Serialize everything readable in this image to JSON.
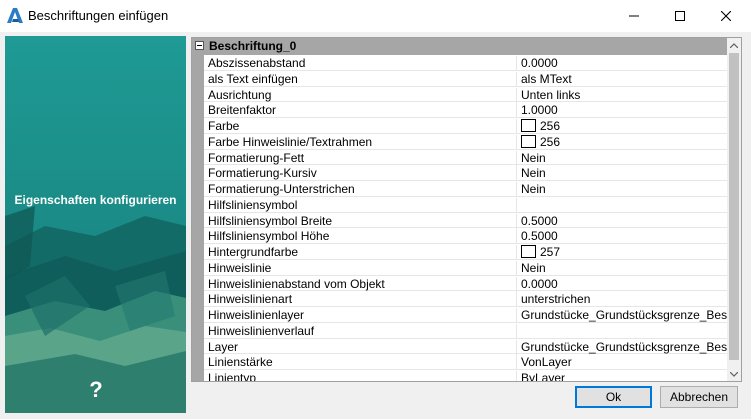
{
  "window": {
    "title": "Beschriftungen einfügen",
    "minimize": "–",
    "maximize": "☐",
    "close": "✕"
  },
  "sidebar": {
    "title": "Eigenschaften konfigurieren",
    "help": "?"
  },
  "category": {
    "label": "Beschriftung_0",
    "toggle": "−"
  },
  "properties": [
    {
      "name": "Abszissenabstand",
      "value": "0.0000"
    },
    {
      "name": "als Text einfügen",
      "value": "als MText"
    },
    {
      "name": "Ausrichtung",
      "value": "Unten links"
    },
    {
      "name": "Breitenfaktor",
      "value": "1.0000"
    },
    {
      "name": "Farbe",
      "value": "256",
      "swatch": true
    },
    {
      "name": "Farbe Hinweislinie/Textrahmen",
      "value": "256",
      "swatch": true
    },
    {
      "name": "Formatierung-Fett",
      "value": "Nein"
    },
    {
      "name": "Formatierung-Kursiv",
      "value": "Nein"
    },
    {
      "name": "Formatierung-Unterstrichen",
      "value": "Nein"
    },
    {
      "name": "Hilfsliniensymbol",
      "value": ""
    },
    {
      "name": "Hilfsliniensymbol Breite",
      "value": "0.5000"
    },
    {
      "name": "Hilfsliniensymbol Höhe",
      "value": "0.5000"
    },
    {
      "name": "Hintergrundfarbe",
      "value": "257",
      "swatch": true
    },
    {
      "name": "Hinweislinie",
      "value": "Nein"
    },
    {
      "name": "Hinweislinienabstand vom Objekt",
      "value": "0.0000"
    },
    {
      "name": "Hinweislinienart",
      "value": "unterstrichen"
    },
    {
      "name": "Hinweislinienlayer",
      "value": "Grundstücke_Grundstücksgrenze_Beschr..."
    },
    {
      "name": "Hinweislinienverlauf",
      "value": ""
    },
    {
      "name": "Layer",
      "value": "Grundstücke_Grundstücksgrenze_Beschr..."
    },
    {
      "name": "Linienstärke",
      "value": "VonLayer"
    },
    {
      "name": "Linientyp",
      "value": "ByLayer"
    }
  ],
  "buttons": {
    "ok": "Ok",
    "cancel": "Abbrechen"
  },
  "colors": {
    "accent": "#0078d7",
    "sidebar_teal": "#1a8a86",
    "category_gray": "#a6a6a6"
  }
}
